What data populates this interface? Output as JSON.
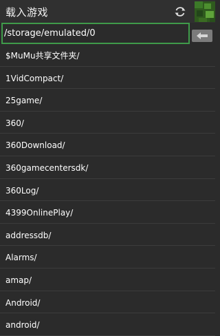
{
  "header": {
    "title": "载入游戏"
  },
  "path": {
    "value": "/storage/emulated/0"
  },
  "list": {
    "items": [
      "$MuMu共享文件夹/",
      "1VidCompact/",
      "25game/",
      "360/",
      "360Download/",
      "360gamecentersdk/",
      "360Log/",
      "4399OnlinePlay/",
      "addressdb/",
      "Alarms/",
      "amap/",
      "Android/",
      "android/"
    ]
  },
  "icons": {
    "refresh": "refresh-icon",
    "back": "back-arrow-icon",
    "thumbnail": "game-thumbnail-image"
  },
  "colors": {
    "background": "#2b2b2b",
    "input_border": "#3f9b4a",
    "back_button": "#7b7b7b"
  }
}
